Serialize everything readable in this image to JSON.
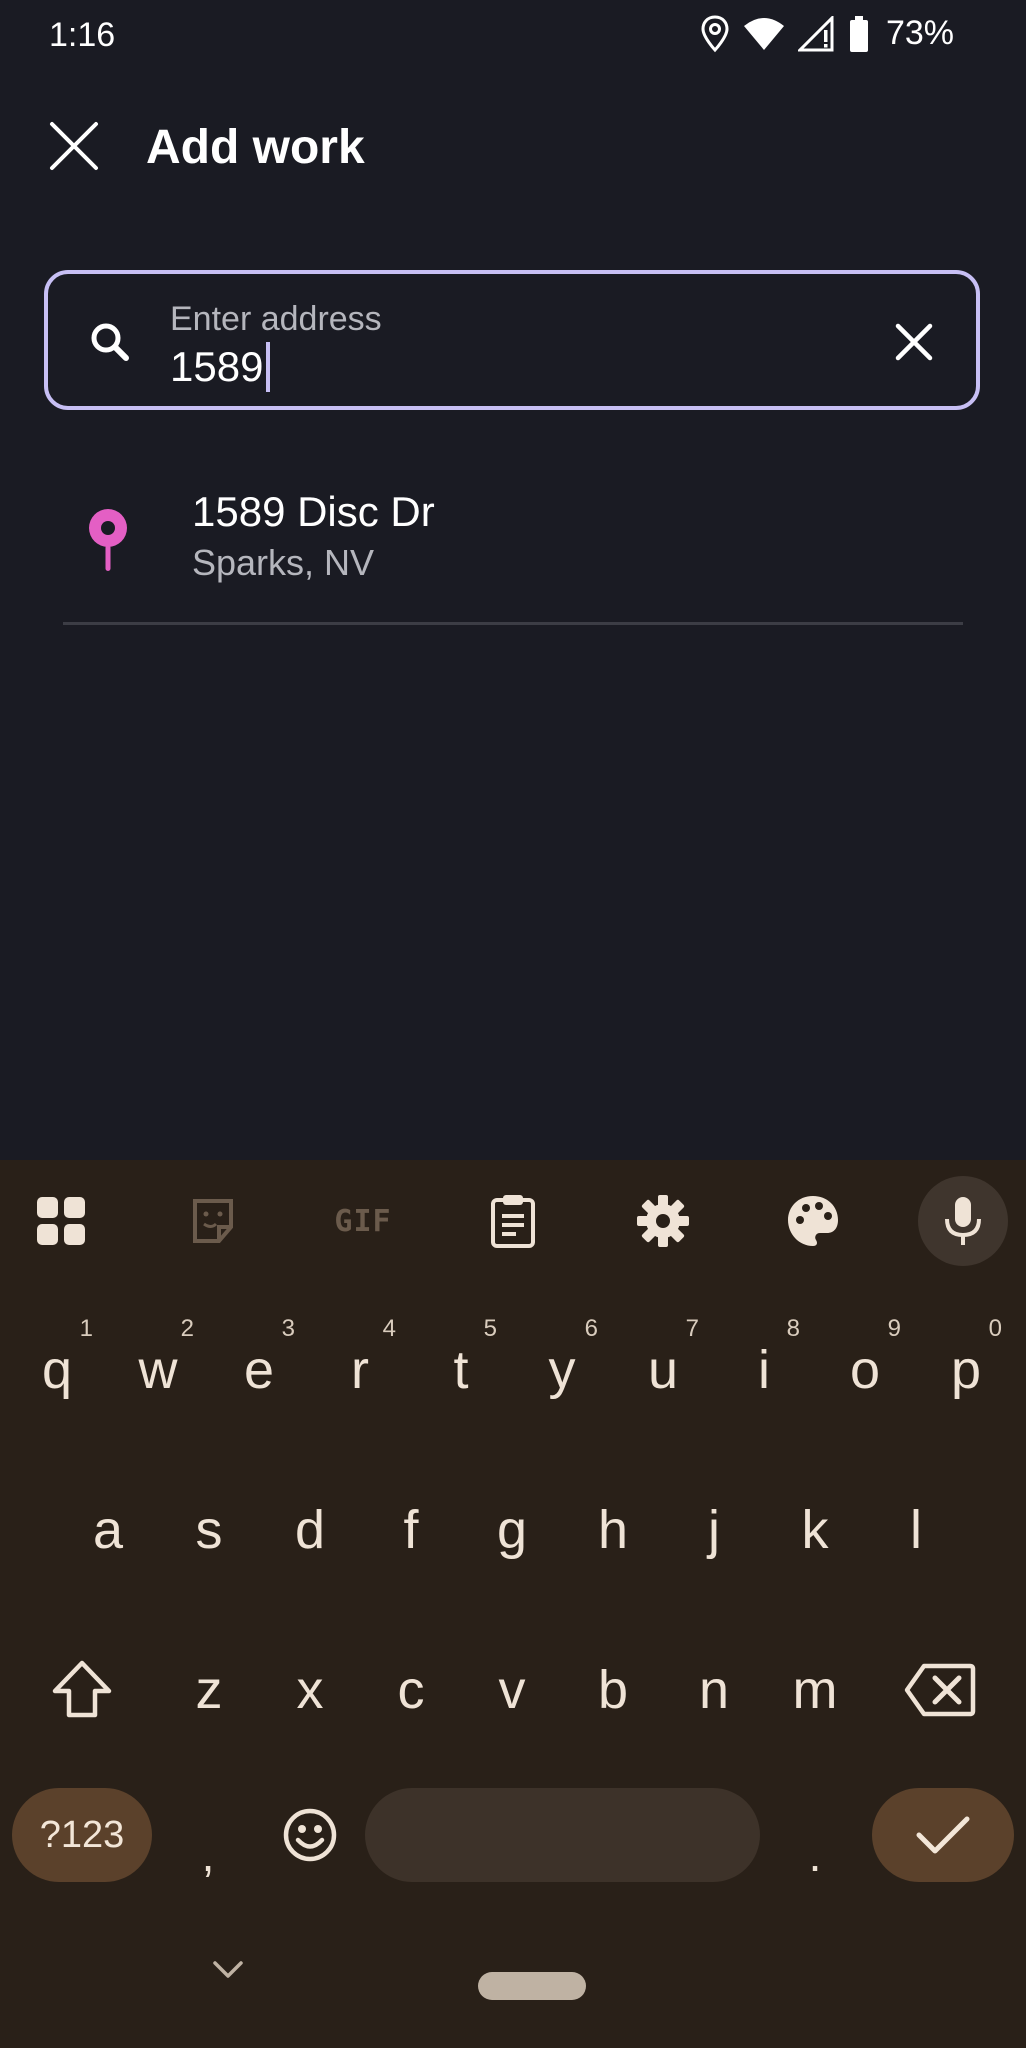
{
  "status_bar": {
    "time": "1:16",
    "battery": "73%",
    "icons": [
      "location-icon",
      "wifi-icon",
      "signal-icon",
      "battery-icon"
    ]
  },
  "header": {
    "title": "Add work",
    "close_icon": "close-icon"
  },
  "search": {
    "label": "Enter address",
    "value": "1589",
    "icon": "search-icon",
    "clear_icon": "clear-icon"
  },
  "results": [
    {
      "title": "1589 Disc Dr",
      "subtitle": "Sparks, NV",
      "icon": "pin-icon"
    }
  ],
  "keyboard": {
    "toolbar": {
      "gif_label": "GIF",
      "icons": [
        "apps-grid-icon",
        "sticker-icon",
        "gif-icon",
        "clipboard-icon",
        "settings-icon",
        "palette-icon",
        "mic-icon"
      ]
    },
    "row1": [
      {
        "key": "q",
        "hint": "1"
      },
      {
        "key": "w",
        "hint": "2"
      },
      {
        "key": "e",
        "hint": "3"
      },
      {
        "key": "r",
        "hint": "4"
      },
      {
        "key": "t",
        "hint": "5"
      },
      {
        "key": "y",
        "hint": "6"
      },
      {
        "key": "u",
        "hint": "7"
      },
      {
        "key": "i",
        "hint": "8"
      },
      {
        "key": "o",
        "hint": "9"
      },
      {
        "key": "p",
        "hint": "0"
      }
    ],
    "row2": [
      "a",
      "s",
      "d",
      "f",
      "g",
      "h",
      "j",
      "k",
      "l"
    ],
    "row3": [
      "z",
      "x",
      "c",
      "v",
      "b",
      "n",
      "m"
    ],
    "symbols_label": "?123",
    "comma": ",",
    "period": ".",
    "colors": {
      "background": "#292018",
      "accent_pill": "#5b412b",
      "space_bar": "#3d3229"
    }
  },
  "colors": {
    "background": "#1a1b23",
    "field_outline": "#c7bff4",
    "pin": "#e45fc4"
  }
}
